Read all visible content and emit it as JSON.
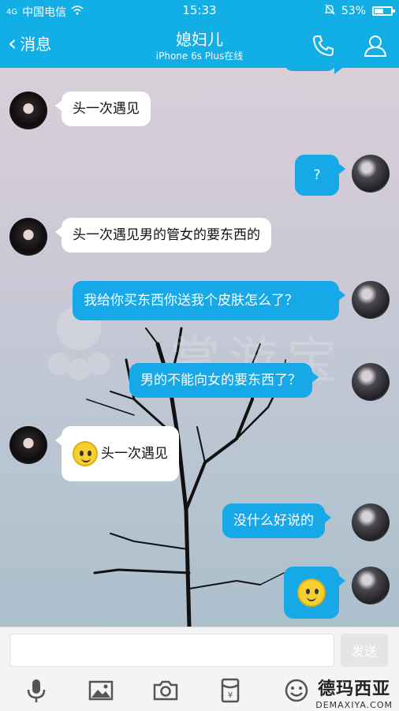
{
  "status": {
    "signal_label": "4G",
    "carrier": "中国电信",
    "time": "15:33",
    "battery": "53%",
    "battery_level": 0.53
  },
  "header": {
    "back_label": "消息",
    "title": "媳妇儿",
    "subtitle": "iPhone 6s Plus在线"
  },
  "messages": [
    {
      "side": "in",
      "text": "头一次遇见"
    },
    {
      "side": "out",
      "text": "?"
    },
    {
      "side": "in",
      "text": "头一次遇见男的管女的要东西的"
    },
    {
      "side": "out",
      "text": "我给你买东西你送我个皮肤怎么了？"
    },
    {
      "side": "out",
      "text": "男的不能向女的要东西了？"
    },
    {
      "side": "in",
      "text": "头一次遇见",
      "emoji": "sweat-smile-emoji"
    },
    {
      "side": "out",
      "text": "没什么好说的"
    },
    {
      "side": "out",
      "text": "",
      "emoji": "smile-emoji"
    }
  ],
  "watermark": {
    "text": "掌游宝"
  },
  "composer": {
    "input_value": "",
    "send_label": "发送"
  },
  "toolbar": {
    "icons": [
      "microphone-icon",
      "image-icon",
      "camera-icon",
      "red-packet-icon",
      "emoji-icon"
    ]
  },
  "footer_watermark": {
    "cn": "德玛西亚",
    "en": "DEMAXIYA.COM"
  },
  "colors": {
    "accent": "#12aee6",
    "outgoing_bubble": "#17a8e7",
    "incoming_bubble": "#ffffff"
  }
}
